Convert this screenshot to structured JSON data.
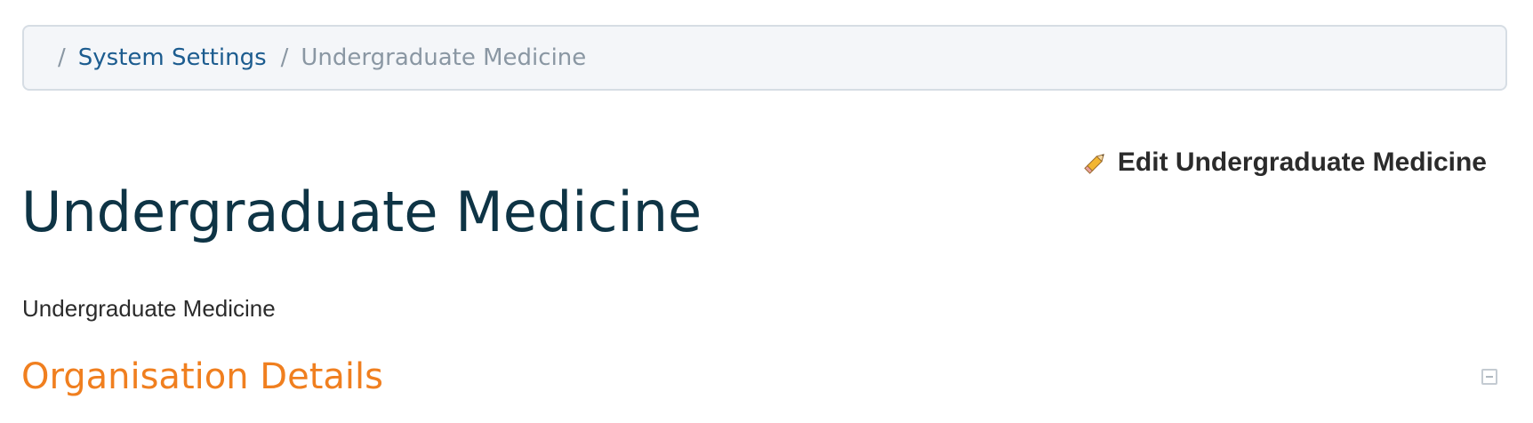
{
  "breadcrumb": {
    "separator": "/",
    "items": [
      {
        "label": "System Settings",
        "link": true
      },
      {
        "label": "Undergraduate Medicine",
        "link": false
      }
    ]
  },
  "edit_action": {
    "label": "Edit Undergraduate Medicine",
    "icon": "pencil-icon"
  },
  "page": {
    "title": "Undergraduate Medicine",
    "description": "Undergraduate Medicine"
  },
  "section": {
    "title": "Organisation Details",
    "toggle_icon": "collapse-icon"
  },
  "colors": {
    "link": "#1c5c8f",
    "title": "#0e3445",
    "section_heading": "#f07f1f",
    "breadcrumb_bg": "#f4f6f9"
  }
}
